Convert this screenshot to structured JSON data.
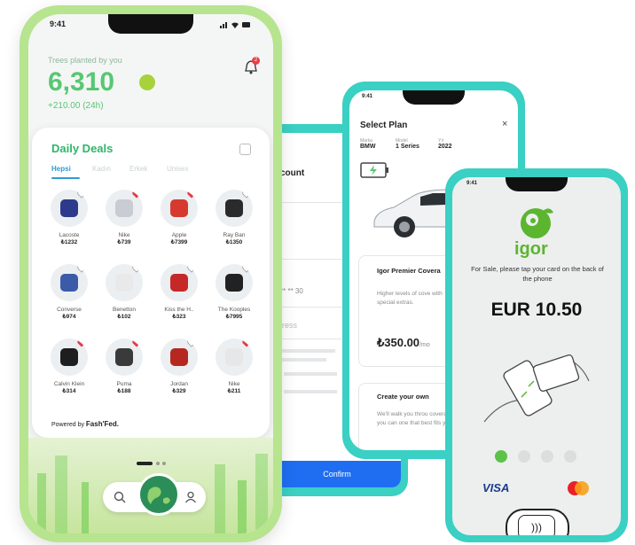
{
  "phone1": {
    "time": "9:41",
    "trees_label": "Trees planted by you",
    "trees_value": "6,310",
    "trees_delta": "+210.00 (24h)",
    "notification_count": "2",
    "deals_title": "Daily Deals",
    "tabs": [
      "Hepsi",
      "Kadın",
      "Erkek",
      "Unisex"
    ],
    "items": [
      {
        "name": "Lacoste",
        "price": "₺1232",
        "liked": false
      },
      {
        "name": "Nike",
        "price": "₺739",
        "liked": true
      },
      {
        "name": "Apple",
        "price": "₺7399",
        "liked": true
      },
      {
        "name": "Ray Ban",
        "price": "₺1350",
        "liked": false
      },
      {
        "name": "Converse",
        "price": "₺974",
        "liked": false
      },
      {
        "name": "Benetton",
        "price": "₺102",
        "liked": false
      },
      {
        "name": "Kiss the H..",
        "price": "₺323",
        "liked": false
      },
      {
        "name": "The Kooples",
        "price": "₺7995",
        "liked": false
      },
      {
        "name": "Calvin Klein",
        "price": "₺314",
        "liked": true
      },
      {
        "name": "Puma",
        "price": "₺188",
        "liked": true
      },
      {
        "name": "Jordan",
        "price": "₺329",
        "liked": false
      },
      {
        "name": "Nike",
        "price": "₺211",
        "liked": true
      }
    ],
    "powered_by": "Powered by",
    "brand": "Fash'Fed."
  },
  "phone2": {
    "heading": "count",
    "field_value": "** ** 30",
    "placeholder": "ddress",
    "confirm": "Confirm"
  },
  "phone3": {
    "time": "9:41",
    "title": "Select Plan",
    "close": "×",
    "specs": [
      {
        "label": "Marka",
        "value": "BMW"
      },
      {
        "label": "Model",
        "value": "1 Series"
      },
      {
        "label": "Yıl",
        "value": "2022"
      }
    ],
    "plan1_title": "Igor Premier Covera",
    "plan1_desc": "Higher levels of cove with special extras.",
    "plan1_price": "₺350.00",
    "plan1_unit": "/mo",
    "plan2_title": "Create your own",
    "plan2_desc": "We'll walk you throu coverage so you can one that best fits yo"
  },
  "phone4": {
    "time": "9:41",
    "brand": "igor",
    "sale_text": "For Sale, please tap your card on the back of the phone",
    "amount": "EUR 10.50",
    "active_dot": 0,
    "dot_count": 4,
    "visa": "VISA"
  },
  "colors": {
    "green_frame": "#b7e48e",
    "teal_frame": "#3ad0c3",
    "accent_green": "#58c773",
    "confirm_blue": "#1f6ef2"
  }
}
